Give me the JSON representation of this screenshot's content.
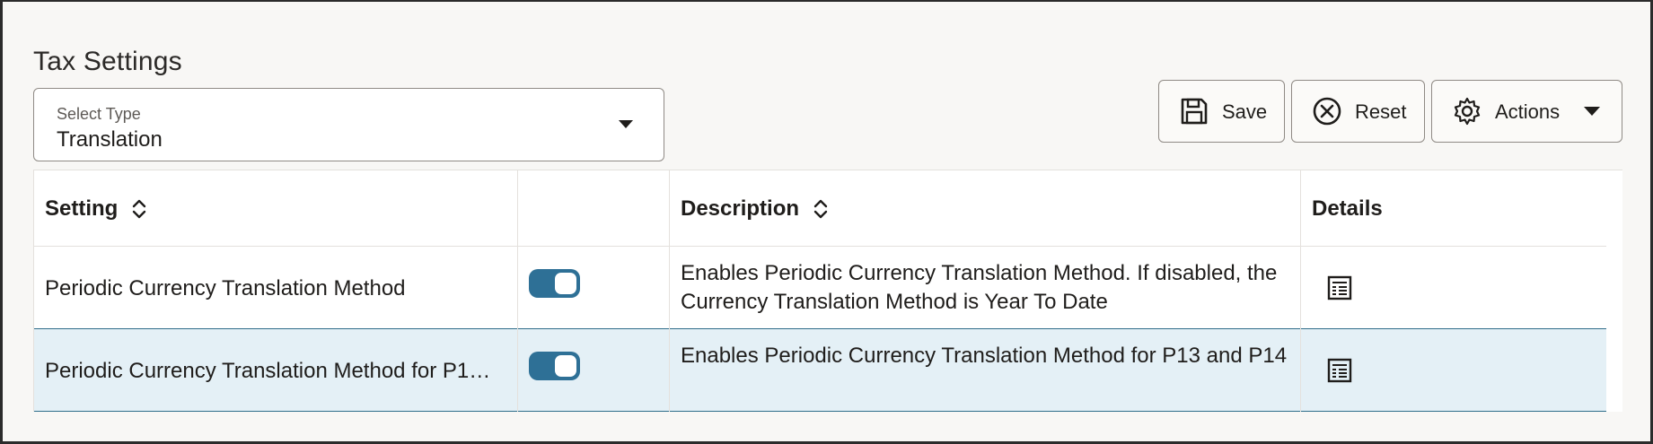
{
  "page": {
    "title": "Tax Settings"
  },
  "select_type": {
    "label": "Select Type",
    "value": "Translation"
  },
  "toolbar": {
    "save_label": "Save",
    "reset_label": "Reset",
    "actions_label": "Actions"
  },
  "table": {
    "columns": [
      "Setting",
      "",
      "Description",
      "Details"
    ],
    "rows": [
      {
        "setting": "Periodic Currency Translation Method",
        "enabled": true,
        "description": "Enables Periodic Currency Translation Method. If disabled, the Currency Translation Method is Year To Date",
        "details_icon": "details-icon"
      },
      {
        "setting": "Periodic Currency Translation Method for P1…",
        "enabled": true,
        "description": "Enables Periodic Currency Translation Method for P13 and P14",
        "details_icon": "details-icon"
      }
    ]
  },
  "colors": {
    "toggle_on": "#2e7096",
    "selected_row": "#e4f0f6",
    "row_divider": "#2f6d8a"
  }
}
